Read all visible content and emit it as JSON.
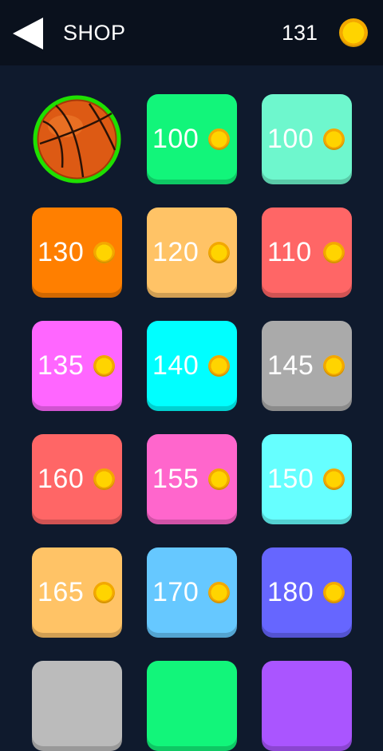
{
  "header": {
    "title": "SHOP",
    "coin_balance": "131",
    "back_icon": "back-arrow-icon",
    "coin_icon": "coin-icon"
  },
  "shop": {
    "selected_item": {
      "icon": "basketball-icon",
      "ring_color": "#1fe000"
    },
    "items": [
      {
        "price": "100",
        "color": "#12f57a"
      },
      {
        "price": "100",
        "color": "#6ef7cd"
      },
      {
        "price": "130",
        "color": "#ff7f00"
      },
      {
        "price": "120",
        "color": "#ffc366"
      },
      {
        "price": "110",
        "color": "#ff6666"
      },
      {
        "price": "135",
        "color": "#ff66ff"
      },
      {
        "price": "140",
        "color": "#00ffff"
      },
      {
        "price": "145",
        "color": "#aaaaaa"
      },
      {
        "price": "160",
        "color": "#ff6666"
      },
      {
        "price": "155",
        "color": "#ff66cc"
      },
      {
        "price": "150",
        "color": "#66ffff"
      },
      {
        "price": "165",
        "color": "#ffc366"
      },
      {
        "price": "170",
        "color": "#66c8ff"
      },
      {
        "price": "180",
        "color": "#6666ff"
      },
      {
        "price": "",
        "color": "#bbbbbb"
      },
      {
        "price": "",
        "color": "#12f57a"
      },
      {
        "price": "",
        "color": "#aa55ff"
      }
    ]
  }
}
